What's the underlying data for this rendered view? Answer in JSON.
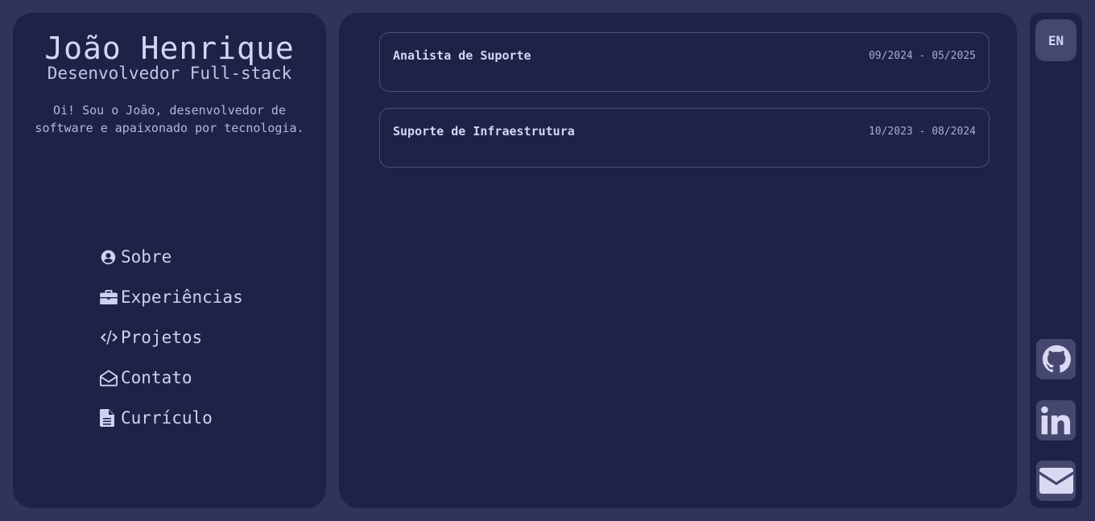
{
  "profile": {
    "name": "João Henrique",
    "role": "Desenvolvedor Full-stack",
    "bio": "Oi! Sou o João, desenvolvedor de software e apaixonado por tecnologia."
  },
  "nav": {
    "items": [
      {
        "label": "Sobre",
        "icon": "user-circle-icon"
      },
      {
        "label": "Experiências",
        "icon": "briefcase-icon"
      },
      {
        "label": "Projetos",
        "icon": "code-icon"
      },
      {
        "label": "Contato",
        "icon": "envelope-open-icon"
      },
      {
        "label": "Currículo",
        "icon": "file-icon"
      }
    ]
  },
  "experiences": [
    {
      "title": "Analista de Suporte",
      "dates": "09/2024 - 05/2025"
    },
    {
      "title": "Suporte de Infraestrutura",
      "dates": "10/2023 - 08/2024"
    }
  ],
  "sidebar": {
    "language_button": "EN",
    "socials": [
      {
        "icon": "github-icon"
      },
      {
        "icon": "linkedin-icon"
      },
      {
        "icon": "email-icon"
      }
    ]
  },
  "colors": {
    "background": "#30335a",
    "panel": "#1f2147",
    "accent": "#45476f",
    "text": "#c9cbea"
  }
}
